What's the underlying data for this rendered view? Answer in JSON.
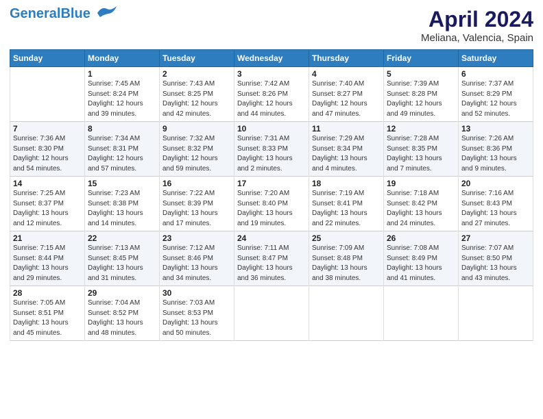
{
  "logo": {
    "line1": "General",
    "line2": "Blue"
  },
  "title": "April 2024",
  "subtitle": "Meliana, Valencia, Spain",
  "days_header": [
    "Sunday",
    "Monday",
    "Tuesday",
    "Wednesday",
    "Thursday",
    "Friday",
    "Saturday"
  ],
  "weeks": [
    [
      {
        "num": "",
        "info": ""
      },
      {
        "num": "1",
        "info": "Sunrise: 7:45 AM\nSunset: 8:24 PM\nDaylight: 12 hours\nand 39 minutes."
      },
      {
        "num": "2",
        "info": "Sunrise: 7:43 AM\nSunset: 8:25 PM\nDaylight: 12 hours\nand 42 minutes."
      },
      {
        "num": "3",
        "info": "Sunrise: 7:42 AM\nSunset: 8:26 PM\nDaylight: 12 hours\nand 44 minutes."
      },
      {
        "num": "4",
        "info": "Sunrise: 7:40 AM\nSunset: 8:27 PM\nDaylight: 12 hours\nand 47 minutes."
      },
      {
        "num": "5",
        "info": "Sunrise: 7:39 AM\nSunset: 8:28 PM\nDaylight: 12 hours\nand 49 minutes."
      },
      {
        "num": "6",
        "info": "Sunrise: 7:37 AM\nSunset: 8:29 PM\nDaylight: 12 hours\nand 52 minutes."
      }
    ],
    [
      {
        "num": "7",
        "info": "Sunrise: 7:36 AM\nSunset: 8:30 PM\nDaylight: 12 hours\nand 54 minutes."
      },
      {
        "num": "8",
        "info": "Sunrise: 7:34 AM\nSunset: 8:31 PM\nDaylight: 12 hours\nand 57 minutes."
      },
      {
        "num": "9",
        "info": "Sunrise: 7:32 AM\nSunset: 8:32 PM\nDaylight: 12 hours\nand 59 minutes."
      },
      {
        "num": "10",
        "info": "Sunrise: 7:31 AM\nSunset: 8:33 PM\nDaylight: 13 hours\nand 2 minutes."
      },
      {
        "num": "11",
        "info": "Sunrise: 7:29 AM\nSunset: 8:34 PM\nDaylight: 13 hours\nand 4 minutes."
      },
      {
        "num": "12",
        "info": "Sunrise: 7:28 AM\nSunset: 8:35 PM\nDaylight: 13 hours\nand 7 minutes."
      },
      {
        "num": "13",
        "info": "Sunrise: 7:26 AM\nSunset: 8:36 PM\nDaylight: 13 hours\nand 9 minutes."
      }
    ],
    [
      {
        "num": "14",
        "info": "Sunrise: 7:25 AM\nSunset: 8:37 PM\nDaylight: 13 hours\nand 12 minutes."
      },
      {
        "num": "15",
        "info": "Sunrise: 7:23 AM\nSunset: 8:38 PM\nDaylight: 13 hours\nand 14 minutes."
      },
      {
        "num": "16",
        "info": "Sunrise: 7:22 AM\nSunset: 8:39 PM\nDaylight: 13 hours\nand 17 minutes."
      },
      {
        "num": "17",
        "info": "Sunrise: 7:20 AM\nSunset: 8:40 PM\nDaylight: 13 hours\nand 19 minutes."
      },
      {
        "num": "18",
        "info": "Sunrise: 7:19 AM\nSunset: 8:41 PM\nDaylight: 13 hours\nand 22 minutes."
      },
      {
        "num": "19",
        "info": "Sunrise: 7:18 AM\nSunset: 8:42 PM\nDaylight: 13 hours\nand 24 minutes."
      },
      {
        "num": "20",
        "info": "Sunrise: 7:16 AM\nSunset: 8:43 PM\nDaylight: 13 hours\nand 27 minutes."
      }
    ],
    [
      {
        "num": "21",
        "info": "Sunrise: 7:15 AM\nSunset: 8:44 PM\nDaylight: 13 hours\nand 29 minutes."
      },
      {
        "num": "22",
        "info": "Sunrise: 7:13 AM\nSunset: 8:45 PM\nDaylight: 13 hours\nand 31 minutes."
      },
      {
        "num": "23",
        "info": "Sunrise: 7:12 AM\nSunset: 8:46 PM\nDaylight: 13 hours\nand 34 minutes."
      },
      {
        "num": "24",
        "info": "Sunrise: 7:11 AM\nSunset: 8:47 PM\nDaylight: 13 hours\nand 36 minutes."
      },
      {
        "num": "25",
        "info": "Sunrise: 7:09 AM\nSunset: 8:48 PM\nDaylight: 13 hours\nand 38 minutes."
      },
      {
        "num": "26",
        "info": "Sunrise: 7:08 AM\nSunset: 8:49 PM\nDaylight: 13 hours\nand 41 minutes."
      },
      {
        "num": "27",
        "info": "Sunrise: 7:07 AM\nSunset: 8:50 PM\nDaylight: 13 hours\nand 43 minutes."
      }
    ],
    [
      {
        "num": "28",
        "info": "Sunrise: 7:05 AM\nSunset: 8:51 PM\nDaylight: 13 hours\nand 45 minutes."
      },
      {
        "num": "29",
        "info": "Sunrise: 7:04 AM\nSunset: 8:52 PM\nDaylight: 13 hours\nand 48 minutes."
      },
      {
        "num": "30",
        "info": "Sunrise: 7:03 AM\nSunset: 8:53 PM\nDaylight: 13 hours\nand 50 minutes."
      },
      {
        "num": "",
        "info": ""
      },
      {
        "num": "",
        "info": ""
      },
      {
        "num": "",
        "info": ""
      },
      {
        "num": "",
        "info": ""
      }
    ]
  ]
}
